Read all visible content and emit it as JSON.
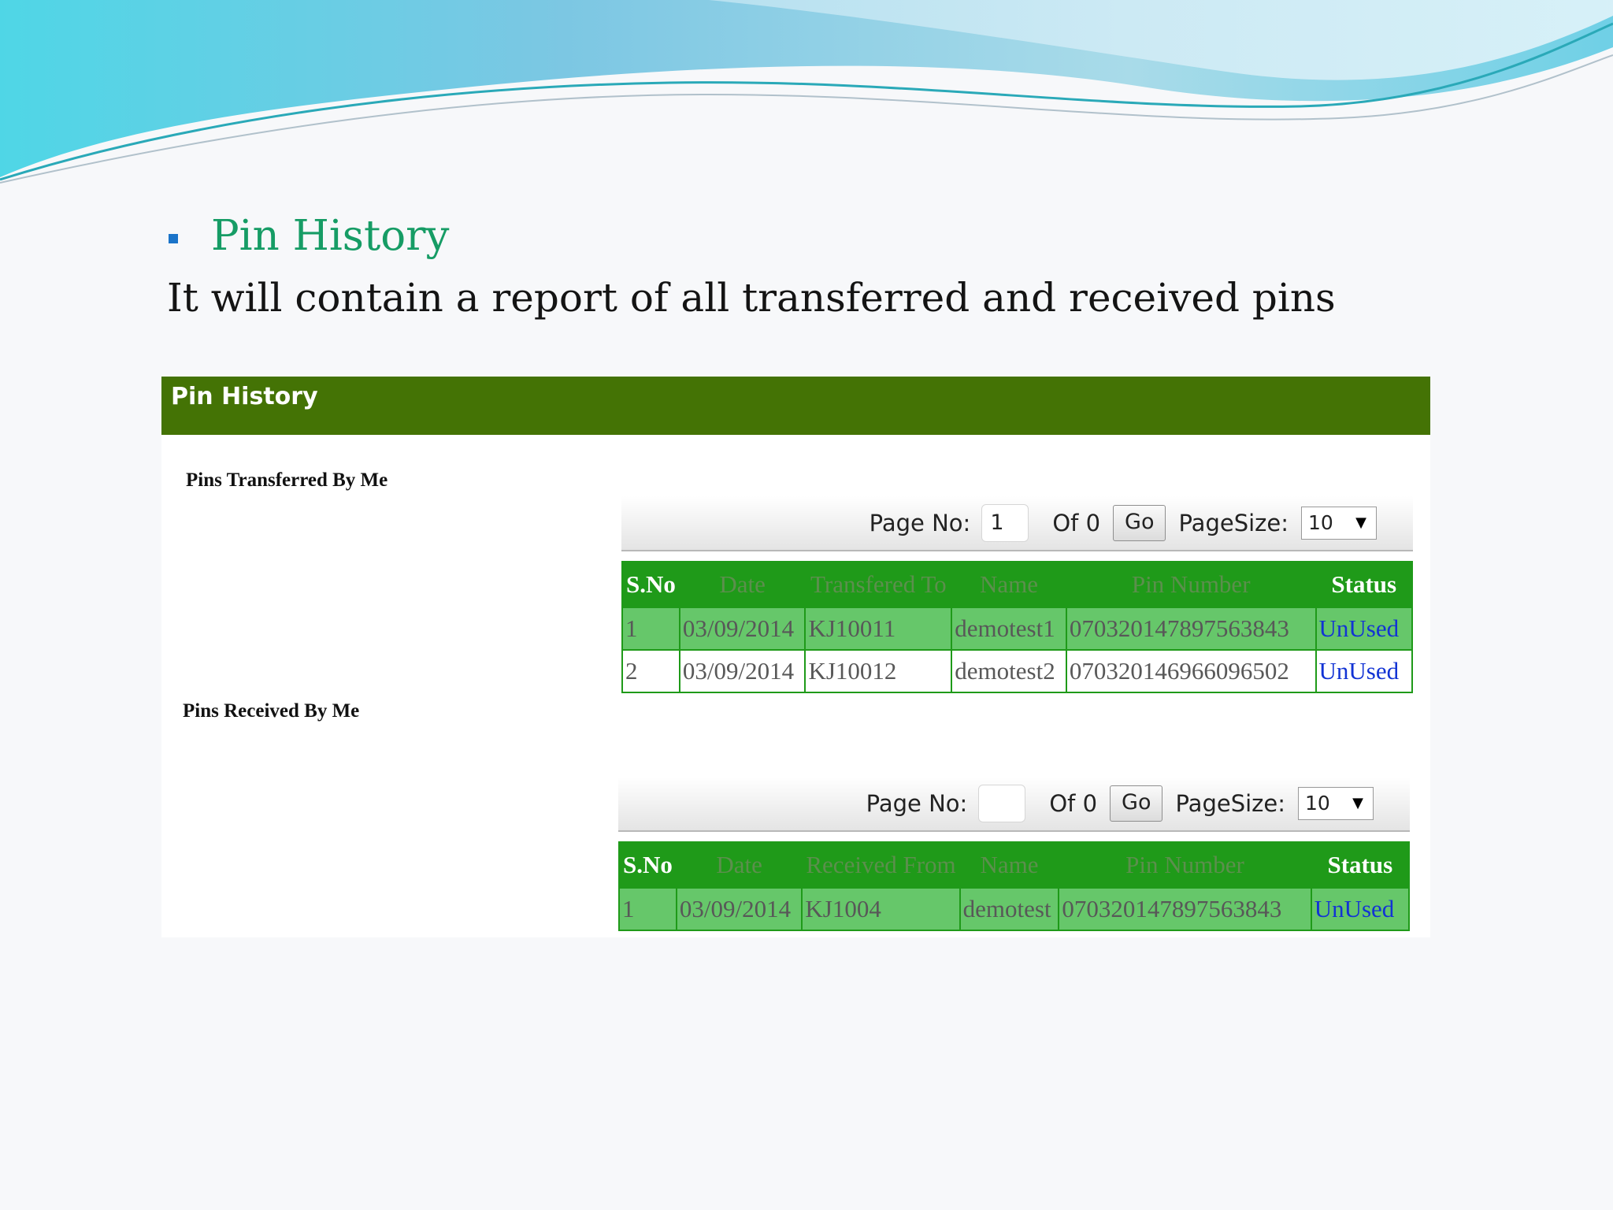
{
  "slide": {
    "heading": "Pin History",
    "subheading": "It will contain a report of all transferred and received pins"
  },
  "panel": {
    "title": "Pin History"
  },
  "transferred": {
    "label": "Pins Transferred By Me",
    "pager": {
      "page_no_label": "Page No:",
      "page_no_value": "1",
      "of_label": "Of 0",
      "go_label": "Go",
      "page_size_label": "PageSize:",
      "page_size_value": "10"
    },
    "columns": [
      "S.No",
      "Date",
      "Transfered To",
      "Name",
      "Pin Number",
      "Status"
    ],
    "rows": [
      [
        "1",
        "03/09/2014",
        "KJ10011",
        "demotest1",
        "070320147897563843",
        "UnUsed"
      ],
      [
        "2",
        "03/09/2014",
        "KJ10012",
        "demotest2",
        "070320146966096502",
        "UnUsed"
      ]
    ]
  },
  "received": {
    "label": "Pins Received By Me",
    "pager": {
      "page_no_label": "Page No:",
      "page_no_value": "",
      "of_label": "Of 0",
      "go_label": "Go",
      "page_size_label": "PageSize:",
      "page_size_value": "10"
    },
    "columns": [
      "S.No",
      "Date",
      "Received From",
      "Name",
      "Pin Number",
      "Status"
    ],
    "rows": [
      [
        "1",
        "03/09/2014",
        "KJ1004",
        "demotest",
        "070320147897563843",
        "UnUsed"
      ]
    ]
  },
  "colors": {
    "header_green": "#447305",
    "table_header_green": "#1f9a19",
    "row_green": "#66c76a",
    "heading_green": "#169c65",
    "status_blue": "#1233d4"
  }
}
